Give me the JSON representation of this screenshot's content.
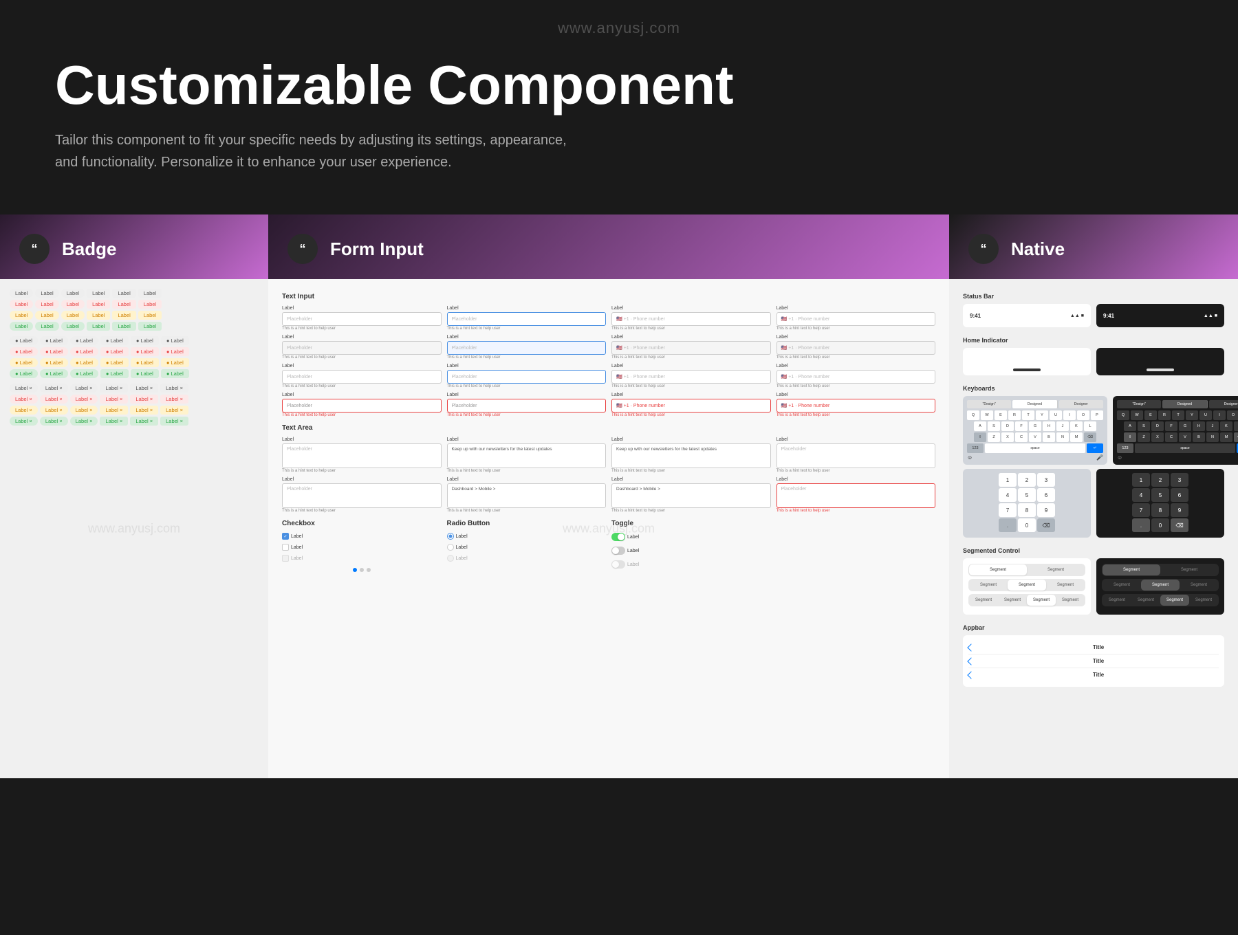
{
  "page": {
    "watermark": "www.anyusj.com",
    "header": {
      "title": "Customizable Component",
      "subtitle": "Tailor this component to fit your specific needs by adjusting its settings, appearance, and functionality. Personalize it to enhance your user experience."
    }
  },
  "cards": {
    "badge": {
      "icon": "“",
      "title": "Badge",
      "rows": [
        [
          "Label",
          "Label",
          "Label",
          "Label",
          "Label",
          "Label"
        ],
        [
          "Label",
          "Label",
          "Label",
          "Label",
          "Label",
          "Label"
        ],
        [
          "Label",
          "Label",
          "Label",
          "Label",
          "Label",
          "Label"
        ],
        [
          "Label",
          "Label",
          "Label",
          "Label",
          "Label",
          "Label"
        ],
        [
          "Label",
          "Label",
          "Label",
          "Label",
          "Label",
          "Label"
        ],
        [
          "Label",
          "Label",
          "Label",
          "Label",
          "Label",
          "Label"
        ],
        [
          "Label",
          "Label",
          "Label",
          "Label",
          "Label",
          "Label"
        ],
        [
          "Label",
          "Label",
          "Label",
          "Label",
          "Label",
          "Label"
        ],
        [
          "Label",
          "Label",
          "Label",
          "Label",
          "Label",
          "Label"
        ],
        [
          "Label",
          "Label",
          "Label",
          "Label",
          "Label",
          "Label"
        ],
        [
          "Label",
          "Label",
          "Label",
          "Label",
          "Label",
          "Label"
        ],
        [
          "Label",
          "Label",
          "Label",
          "Label",
          "Label",
          "Label"
        ]
      ]
    },
    "formInput": {
      "icon": "“",
      "title": "Form Input",
      "sections": {
        "textInput": "Text Input",
        "textArea": "Text Area",
        "checkbox": "Checkbox",
        "radioButton": "Radio Button",
        "toggle": "Toggle"
      }
    },
    "native": {
      "icon": "“",
      "title": "Native",
      "sections": {
        "statusBar": "Status Bar",
        "homeIndicator": "Home Indicator",
        "keyboards": "Keyboards",
        "segmentedControl": "Segmented Control",
        "appbar": "Appbar"
      },
      "statusBar": {
        "timeLight": "9:41",
        "timeDark": "9:41"
      },
      "keyboard": {
        "rows": [
          [
            "Q",
            "W",
            "E",
            "R",
            "T",
            "Y",
            "U",
            "I",
            "O",
            "P"
          ],
          [
            "A",
            "S",
            "D",
            "F",
            "G",
            "H",
            "J",
            "K",
            "L"
          ],
          [
            "Z",
            "X",
            "C",
            "V",
            "B",
            "N",
            "M"
          ],
          [
            "123",
            "space",
            "↵"
          ]
        ],
        "numRows": [
          [
            "1",
            "2",
            "3"
          ],
          [
            "4",
            "5",
            "6"
          ],
          [
            "7",
            "8",
            "9"
          ],
          [
            ".",
            "0",
            "⌫"
          ]
        ],
        "autocomplete": [
          "\"Design\"",
          "Designed",
          "Designer"
        ]
      },
      "segmented": {
        "options1": [
          "Segment",
          "Segment"
        ],
        "options2": [
          "Segment",
          "Segment",
          "Segment"
        ],
        "options3": [
          "Segment",
          "Segment",
          "Segment",
          "Segment"
        ]
      },
      "appbar": {
        "rows": [
          "Title",
          "Title",
          "Title"
        ]
      }
    }
  }
}
